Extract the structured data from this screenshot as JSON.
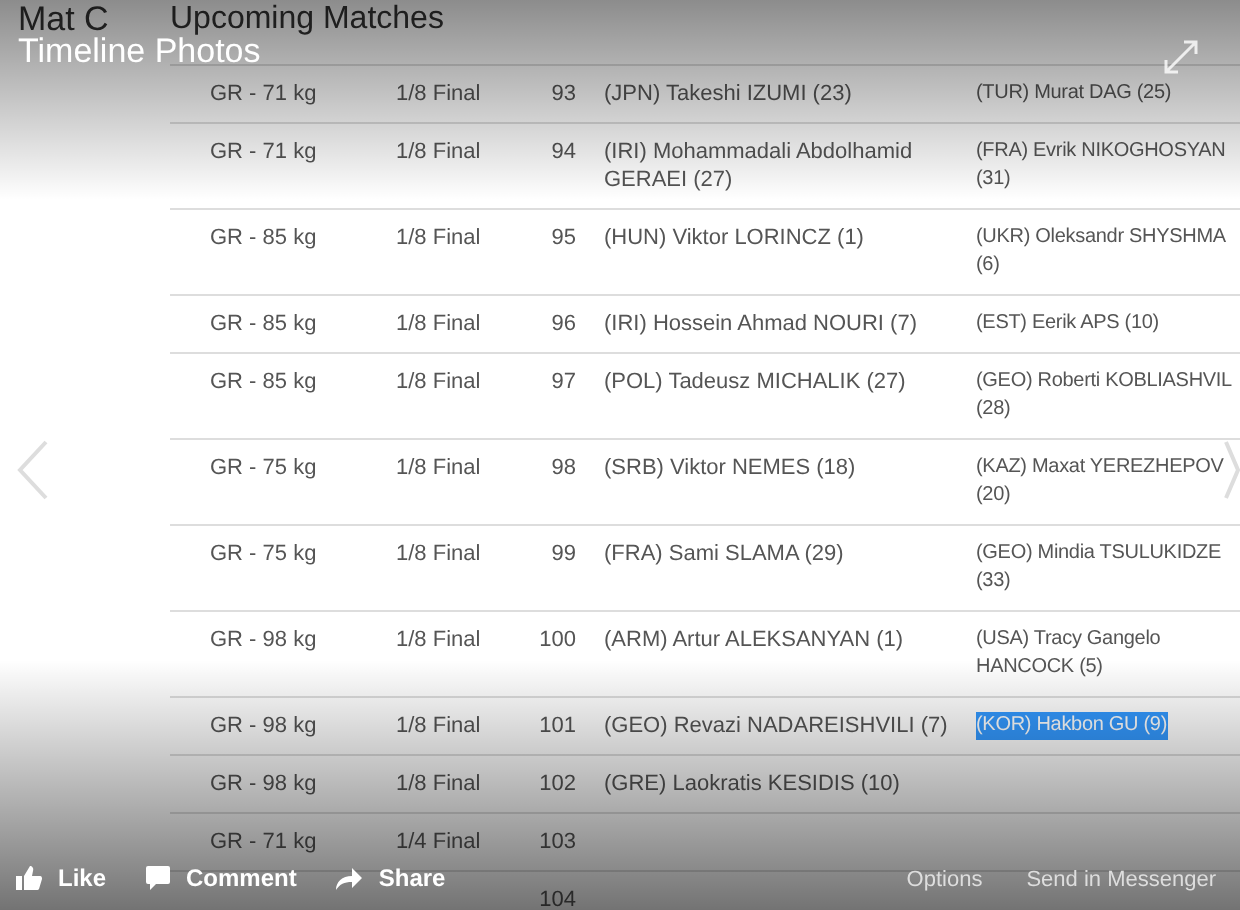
{
  "viewer": {
    "title": "Timeline Photos",
    "actions": [
      {
        "kind": "like",
        "label": "Like"
      },
      {
        "kind": "comment",
        "label": "Comment"
      },
      {
        "kind": "share",
        "label": "Share"
      }
    ],
    "links": [
      "Options",
      "Send in Messenger"
    ]
  },
  "page": {
    "mat_title": "Mat C",
    "heading": "Upcoming Matches"
  },
  "table": {
    "rows": [
      {
        "weight": "GR - 71 kg",
        "round": "1/8 Final",
        "number": "93",
        "red": [
          "(JPN) Takeshi IZUMI (23)"
        ],
        "blue": [
          "(TUR) Murat DAG (25)"
        ],
        "highlighted": false
      },
      {
        "weight": "GR - 71 kg",
        "round": "1/8 Final",
        "number": "94",
        "red": [
          "(IRI) Mohammadali Abdolhamid",
          "GERAEI (27)"
        ],
        "blue": [
          "(FRA) Evrik NIKOGHOSYAN",
          "(31)"
        ],
        "highlighted": false
      },
      {
        "weight": "GR - 85 kg",
        "round": "1/8 Final",
        "number": "95",
        "red": [
          "(HUN) Viktor LORINCZ (1)"
        ],
        "blue": [
          "(UKR) Oleksandr SHYSHMA",
          "(6)"
        ],
        "highlighted": false
      },
      {
        "weight": "GR - 85 kg",
        "round": "1/8 Final",
        "number": "96",
        "red": [
          "(IRI) Hossein Ahmad NOURI (7)"
        ],
        "blue": [
          "(EST) Eerik APS (10)"
        ],
        "highlighted": false
      },
      {
        "weight": "GR - 85 kg",
        "round": "1/8 Final",
        "number": "97",
        "red": [
          "(POL) Tadeusz MICHALIK (27)"
        ],
        "blue": [
          "(GEO) Roberti KOBLIASHVIL",
          "(28)"
        ],
        "highlighted": false
      },
      {
        "weight": "GR - 75 kg",
        "round": "1/8 Final",
        "number": "98",
        "red": [
          "(SRB) Viktor NEMES (18)"
        ],
        "blue": [
          "(KAZ) Maxat YEREZHEPOV",
          "(20)"
        ],
        "highlighted": false
      },
      {
        "weight": "GR - 75 kg",
        "round": "1/8 Final",
        "number": "99",
        "red": [
          "(FRA) Sami SLAMA (29)"
        ],
        "blue": [
          "(GEO) Mindia TSULUKIDZE",
          "(33)"
        ],
        "highlighted": false
      },
      {
        "weight": "GR - 98 kg",
        "round": "1/8 Final",
        "number": "100",
        "red": [
          "(ARM) Artur ALEKSANYAN (1)"
        ],
        "blue": [
          "(USA) Tracy Gangelo",
          "HANCOCK (5)"
        ],
        "highlighted": false
      },
      {
        "weight": "GR - 98 kg",
        "round": "1/8 Final",
        "number": "101",
        "red": [
          "(GEO) Revazi NADAREISHVILI (7)"
        ],
        "blue": [
          "(KOR) Hakbon GU (9)"
        ],
        "highlighted": true
      },
      {
        "weight": "GR - 98 kg",
        "round": "1/8 Final",
        "number": "102",
        "red": [
          "(GRE) Laokratis KESIDIS (10)"
        ]
      },
      {
        "weight": "GR - 71 kg",
        "round": "1/4 Final",
        "number": "103"
      },
      {
        "number": "104"
      }
    ]
  }
}
